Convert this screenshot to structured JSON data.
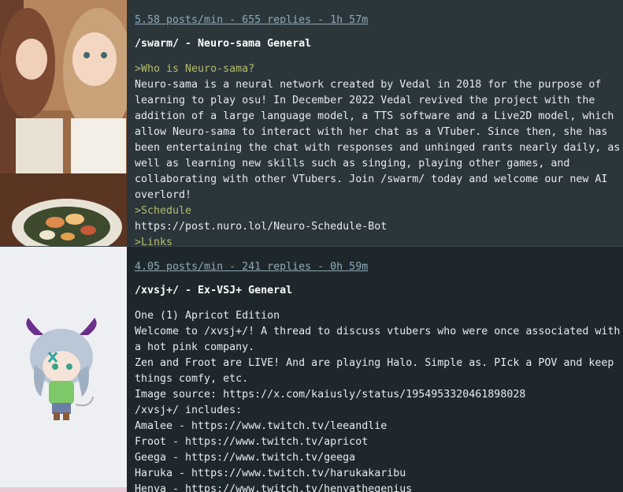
{
  "threads": [
    {
      "stats": "5.58 posts/min - 655 replies - 1h 57m",
      "title": "/swarm/ - Neuro-sama General",
      "lines": [
        {
          "text": ">Who is Neuro-sama?",
          "green": true
        },
        {
          "text": "Neuro-sama is a neural network created by Vedal in 2018 for the purpose of learning to play osu! In December 2022 Vedal revived the project with the addition of a large language model, a TTS software and a Live2D model, which allow Neuro-sama to interact with her chat as a VTuber. Since then, she has been entertaining the chat with responses and unhinged rants nearly daily, as well as learning new skills such as singing, playing other games, and collaborating with other VTubers. Join /swarm/ today and welcome our new AI overlord!",
          "green": false
        },
        {
          "text": ">Schedule",
          "green": true
        },
        {
          "text": "https://post.nuro.lol/Neuro-Schedule-Bot",
          "green": false
        },
        {
          "text": ">Links",
          "green": true
        }
      ]
    },
    {
      "stats": "4.05 posts/min - 241 replies - 0h 59m",
      "title": "/xvsj+/ - Ex-VSJ+ General",
      "lines": [
        {
          "text": "One (1) Apricot Edition",
          "green": false
        },
        {
          "text": "Welcome to /xvsj+/! A thread to discuss vtubers who were once associated with a hot pink company.",
          "green": false
        },
        {
          "text": "Zen and Froot are LIVE! And are playing Halo. Simple as. PIck a POV and keep things comfy, etc.",
          "green": false
        },
        {
          "text": "Image source: https://x.com/kaiusly/status/1954953320461898028",
          "green": false
        },
        {
          "text": "/xvsj+/ includes:",
          "green": false
        },
        {
          "text": "Amalee - https://www.twitch.tv/leeandlie",
          "green": false
        },
        {
          "text": "Froot - https://www.twitch.tv/apricot",
          "green": false
        },
        {
          "text": "Geega - https://www.twitch.tv/geega",
          "green": false
        },
        {
          "text": "Haruka - https://www.twitch.tv/harukakaribu",
          "green": false
        },
        {
          "text": "Henya - https://www.twitch.tv/henyathegenius",
          "green": false
        }
      ]
    }
  ],
  "colors": {
    "greentext": "#b5bd68",
    "stats": "#8fa8b6",
    "thread_bg_1": "#2b363b",
    "thread_bg_2": "#1e282c"
  },
  "icons": [
    "anime-girls-dining-thumbnail",
    "chibi-horned-girl-thumbnail"
  ]
}
